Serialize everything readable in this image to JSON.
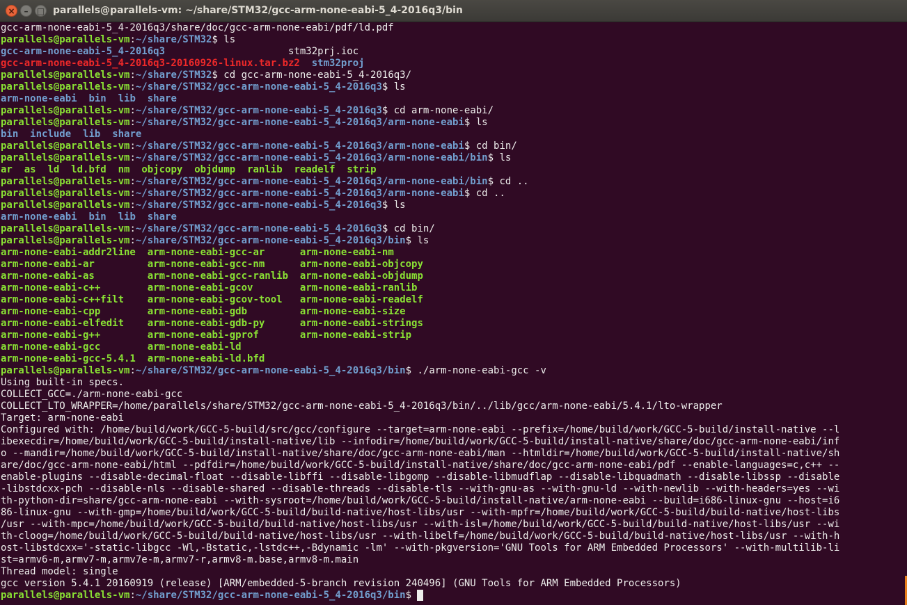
{
  "window": {
    "title": "parallels@parallels-vm: ~/share/STM32/gcc-arm-none-eabi-5_4-2016q3/bin",
    "close_glyph": "×",
    "minimize_glyph": "–",
    "maximize_glyph": "□"
  },
  "colors": {
    "background": "#300a24",
    "prompt": "#8ae234",
    "path": "#729fcf",
    "directory": "#729fcf",
    "executable": "#8ae234",
    "archive": "#ef2929",
    "text": "#eeeeec",
    "scrollbar": "#e87f1c"
  },
  "terminal": {
    "lines": [
      [
        {
          "t": "gcc-arm-none-eabi-5_4-2016q3/share/doc/gcc-arm-none-eabi/pdf/ld.pdf",
          "c": "text"
        }
      ],
      [
        {
          "t": "parallels@parallels-vm",
          "c": "prompt"
        },
        {
          "t": ":",
          "c": "text"
        },
        {
          "t": "~/share/STM32",
          "c": "path"
        },
        {
          "t": "$ ls",
          "c": "text"
        }
      ],
      [
        {
          "t": "gcc-arm-none-eabi-5_4-2016q3",
          "c": "dir"
        },
        {
          "t": "                     stm32prj.ioc",
          "c": "text"
        }
      ],
      [
        {
          "t": "gcc-arm-none-eabi-5_4-2016q3-20160926-linux.tar.bz2",
          "c": "arc"
        },
        {
          "t": "  ",
          "c": "text"
        },
        {
          "t": "stm32proj",
          "c": "dir"
        }
      ],
      [
        {
          "t": "parallels@parallels-vm",
          "c": "prompt"
        },
        {
          "t": ":",
          "c": "text"
        },
        {
          "t": "~/share/STM32",
          "c": "path"
        },
        {
          "t": "$ cd gcc-arm-none-eabi-5_4-2016q3/",
          "c": "text"
        }
      ],
      [
        {
          "t": "parallels@parallels-vm",
          "c": "prompt"
        },
        {
          "t": ":",
          "c": "text"
        },
        {
          "t": "~/share/STM32/gcc-arm-none-eabi-5_4-2016q3",
          "c": "path"
        },
        {
          "t": "$ ls",
          "c": "text"
        }
      ],
      [
        {
          "t": "arm-none-eabi",
          "c": "dir"
        },
        {
          "t": "  ",
          "c": "text"
        },
        {
          "t": "bin",
          "c": "dir"
        },
        {
          "t": "  ",
          "c": "text"
        },
        {
          "t": "lib",
          "c": "dir"
        },
        {
          "t": "  ",
          "c": "text"
        },
        {
          "t": "share",
          "c": "dir"
        }
      ],
      [
        {
          "t": "parallels@parallels-vm",
          "c": "prompt"
        },
        {
          "t": ":",
          "c": "text"
        },
        {
          "t": "~/share/STM32/gcc-arm-none-eabi-5_4-2016q3",
          "c": "path"
        },
        {
          "t": "$ cd arm-none-eabi/",
          "c": "text"
        }
      ],
      [
        {
          "t": "parallels@parallels-vm",
          "c": "prompt"
        },
        {
          "t": ":",
          "c": "text"
        },
        {
          "t": "~/share/STM32/gcc-arm-none-eabi-5_4-2016q3/arm-none-eabi",
          "c": "path"
        },
        {
          "t": "$ ls",
          "c": "text"
        }
      ],
      [
        {
          "t": "bin",
          "c": "dir"
        },
        {
          "t": "  ",
          "c": "text"
        },
        {
          "t": "include",
          "c": "dir"
        },
        {
          "t": "  ",
          "c": "text"
        },
        {
          "t": "lib",
          "c": "dir"
        },
        {
          "t": "  ",
          "c": "text"
        },
        {
          "t": "share",
          "c": "dir"
        }
      ],
      [
        {
          "t": "parallels@parallels-vm",
          "c": "prompt"
        },
        {
          "t": ":",
          "c": "text"
        },
        {
          "t": "~/share/STM32/gcc-arm-none-eabi-5_4-2016q3/arm-none-eabi",
          "c": "path"
        },
        {
          "t": "$ cd bin/",
          "c": "text"
        }
      ],
      [
        {
          "t": "parallels@parallels-vm",
          "c": "prompt"
        },
        {
          "t": ":",
          "c": "text"
        },
        {
          "t": "~/share/STM32/gcc-arm-none-eabi-5_4-2016q3/arm-none-eabi/bin",
          "c": "path"
        },
        {
          "t": "$ ls",
          "c": "text"
        }
      ],
      [
        {
          "t": "ar",
          "c": "exe"
        },
        {
          "t": "  ",
          "c": "text"
        },
        {
          "t": "as",
          "c": "exe"
        },
        {
          "t": "  ",
          "c": "text"
        },
        {
          "t": "ld",
          "c": "exe"
        },
        {
          "t": "  ",
          "c": "text"
        },
        {
          "t": "ld.bfd",
          "c": "exe"
        },
        {
          "t": "  ",
          "c": "text"
        },
        {
          "t": "nm",
          "c": "exe"
        },
        {
          "t": "  ",
          "c": "text"
        },
        {
          "t": "objcopy",
          "c": "exe"
        },
        {
          "t": "  ",
          "c": "text"
        },
        {
          "t": "objdump",
          "c": "exe"
        },
        {
          "t": "  ",
          "c": "text"
        },
        {
          "t": "ranlib",
          "c": "exe"
        },
        {
          "t": "  ",
          "c": "text"
        },
        {
          "t": "readelf",
          "c": "exe"
        },
        {
          "t": "  ",
          "c": "text"
        },
        {
          "t": "strip",
          "c": "exe"
        }
      ],
      [
        {
          "t": "parallels@parallels-vm",
          "c": "prompt"
        },
        {
          "t": ":",
          "c": "text"
        },
        {
          "t": "~/share/STM32/gcc-arm-none-eabi-5_4-2016q3/arm-none-eabi/bin",
          "c": "path"
        },
        {
          "t": "$ cd ..",
          "c": "text"
        }
      ],
      [
        {
          "t": "parallels@parallels-vm",
          "c": "prompt"
        },
        {
          "t": ":",
          "c": "text"
        },
        {
          "t": "~/share/STM32/gcc-arm-none-eabi-5_4-2016q3/arm-none-eabi",
          "c": "path"
        },
        {
          "t": "$ cd ..",
          "c": "text"
        }
      ],
      [
        {
          "t": "parallels@parallels-vm",
          "c": "prompt"
        },
        {
          "t": ":",
          "c": "text"
        },
        {
          "t": "~/share/STM32/gcc-arm-none-eabi-5_4-2016q3",
          "c": "path"
        },
        {
          "t": "$ ls",
          "c": "text"
        }
      ],
      [
        {
          "t": "arm-none-eabi",
          "c": "dir"
        },
        {
          "t": "  ",
          "c": "text"
        },
        {
          "t": "bin",
          "c": "dir"
        },
        {
          "t": "  ",
          "c": "text"
        },
        {
          "t": "lib",
          "c": "dir"
        },
        {
          "t": "  ",
          "c": "text"
        },
        {
          "t": "share",
          "c": "dir"
        }
      ],
      [
        {
          "t": "parallels@parallels-vm",
          "c": "prompt"
        },
        {
          "t": ":",
          "c": "text"
        },
        {
          "t": "~/share/STM32/gcc-arm-none-eabi-5_4-2016q3",
          "c": "path"
        },
        {
          "t": "$ cd bin/",
          "c": "text"
        }
      ],
      [
        {
          "t": "parallels@parallels-vm",
          "c": "prompt"
        },
        {
          "t": ":",
          "c": "text"
        },
        {
          "t": "~/share/STM32/gcc-arm-none-eabi-5_4-2016q3/bin",
          "c": "path"
        },
        {
          "t": "$ ls",
          "c": "text"
        }
      ],
      [
        {
          "t": "arm-none-eabi-addr2line",
          "c": "exe"
        },
        {
          "t": "  ",
          "c": "text"
        },
        {
          "t": "arm-none-eabi-gcc-ar",
          "c": "exe"
        },
        {
          "t": "      ",
          "c": "text"
        },
        {
          "t": "arm-none-eabi-nm",
          "c": "exe"
        }
      ],
      [
        {
          "t": "arm-none-eabi-ar",
          "c": "exe"
        },
        {
          "t": "         ",
          "c": "text"
        },
        {
          "t": "arm-none-eabi-gcc-nm",
          "c": "exe"
        },
        {
          "t": "      ",
          "c": "text"
        },
        {
          "t": "arm-none-eabi-objcopy",
          "c": "exe"
        }
      ],
      [
        {
          "t": "arm-none-eabi-as",
          "c": "exe"
        },
        {
          "t": "         ",
          "c": "text"
        },
        {
          "t": "arm-none-eabi-gcc-ranlib",
          "c": "exe"
        },
        {
          "t": "  ",
          "c": "text"
        },
        {
          "t": "arm-none-eabi-objdump",
          "c": "exe"
        }
      ],
      [
        {
          "t": "arm-none-eabi-c++",
          "c": "exe"
        },
        {
          "t": "        ",
          "c": "text"
        },
        {
          "t": "arm-none-eabi-gcov",
          "c": "exe"
        },
        {
          "t": "        ",
          "c": "text"
        },
        {
          "t": "arm-none-eabi-ranlib",
          "c": "exe"
        }
      ],
      [
        {
          "t": "arm-none-eabi-c++filt",
          "c": "exe"
        },
        {
          "t": "    ",
          "c": "text"
        },
        {
          "t": "arm-none-eabi-gcov-tool",
          "c": "exe"
        },
        {
          "t": "   ",
          "c": "text"
        },
        {
          "t": "arm-none-eabi-readelf",
          "c": "exe"
        }
      ],
      [
        {
          "t": "arm-none-eabi-cpp",
          "c": "exe"
        },
        {
          "t": "        ",
          "c": "text"
        },
        {
          "t": "arm-none-eabi-gdb",
          "c": "exe"
        },
        {
          "t": "         ",
          "c": "text"
        },
        {
          "t": "arm-none-eabi-size",
          "c": "exe"
        }
      ],
      [
        {
          "t": "arm-none-eabi-elfedit",
          "c": "exe"
        },
        {
          "t": "    ",
          "c": "text"
        },
        {
          "t": "arm-none-eabi-gdb-py",
          "c": "exe"
        },
        {
          "t": "      ",
          "c": "text"
        },
        {
          "t": "arm-none-eabi-strings",
          "c": "exe"
        }
      ],
      [
        {
          "t": "arm-none-eabi-g++",
          "c": "exe"
        },
        {
          "t": "        ",
          "c": "text"
        },
        {
          "t": "arm-none-eabi-gprof",
          "c": "exe"
        },
        {
          "t": "       ",
          "c": "text"
        },
        {
          "t": "arm-none-eabi-strip",
          "c": "exe"
        }
      ],
      [
        {
          "t": "arm-none-eabi-gcc",
          "c": "exe"
        },
        {
          "t": "        ",
          "c": "text"
        },
        {
          "t": "arm-none-eabi-ld",
          "c": "exe"
        }
      ],
      [
        {
          "t": "arm-none-eabi-gcc-5.4.1",
          "c": "exe"
        },
        {
          "t": "  ",
          "c": "text"
        },
        {
          "t": "arm-none-eabi-ld.bfd",
          "c": "exe"
        }
      ],
      [
        {
          "t": "parallels@parallels-vm",
          "c": "prompt"
        },
        {
          "t": ":",
          "c": "text"
        },
        {
          "t": "~/share/STM32/gcc-arm-none-eabi-5_4-2016q3/bin",
          "c": "path"
        },
        {
          "t": "$ ./arm-none-eabi-gcc -v",
          "c": "text"
        }
      ],
      [
        {
          "t": "Using built-in specs.",
          "c": "text"
        }
      ],
      [
        {
          "t": "COLLECT_GCC=./arm-none-eabi-gcc",
          "c": "text"
        }
      ],
      [
        {
          "t": "COLLECT_LTO_WRAPPER=/home/parallels/share/STM32/gcc-arm-none-eabi-5_4-2016q3/bin/../lib/gcc/arm-none-eabi/5.4.1/lto-wrapper",
          "c": "text"
        }
      ],
      [
        {
          "t": "Target: arm-none-eabi",
          "c": "text"
        }
      ],
      [
        {
          "t": "Configured with: /home/build/work/GCC-5-build/src/gcc/configure --target=arm-none-eabi --prefix=/home/build/work/GCC-5-build/install-native --l",
          "c": "text"
        }
      ],
      [
        {
          "t": "ibexecdir=/home/build/work/GCC-5-build/install-native/lib --infodir=/home/build/work/GCC-5-build/install-native/share/doc/gcc-arm-none-eabi/inf",
          "c": "text"
        }
      ],
      [
        {
          "t": "o --mandir=/home/build/work/GCC-5-build/install-native/share/doc/gcc-arm-none-eabi/man --htmldir=/home/build/work/GCC-5-build/install-native/sh",
          "c": "text"
        }
      ],
      [
        {
          "t": "are/doc/gcc-arm-none-eabi/html --pdfdir=/home/build/work/GCC-5-build/install-native/share/doc/gcc-arm-none-eabi/pdf --enable-languages=c,c++ --",
          "c": "text"
        }
      ],
      [
        {
          "t": "enable-plugins --disable-decimal-float --disable-libffi --disable-libgomp --disable-libmudflap --disable-libquadmath --disable-libssp --disable",
          "c": "text"
        }
      ],
      [
        {
          "t": "-libstdcxx-pch --disable-nls --disable-shared --disable-threads --disable-tls --with-gnu-as --with-gnu-ld --with-newlib --with-headers=yes --wi",
          "c": "text"
        }
      ],
      [
        {
          "t": "th-python-dir=share/gcc-arm-none-eabi --with-sysroot=/home/build/work/GCC-5-build/install-native/arm-none-eabi --build=i686-linux-gnu --host=i6",
          "c": "text"
        }
      ],
      [
        {
          "t": "86-linux-gnu --with-gmp=/home/build/work/GCC-5-build/build-native/host-libs/usr --with-mpfr=/home/build/work/GCC-5-build/build-native/host-libs",
          "c": "text"
        }
      ],
      [
        {
          "t": "/usr --with-mpc=/home/build/work/GCC-5-build/build-native/host-libs/usr --with-isl=/home/build/work/GCC-5-build/build-native/host-libs/usr --wi",
          "c": "text"
        }
      ],
      [
        {
          "t": "th-cloog=/home/build/work/GCC-5-build/build-native/host-libs/usr --with-libelf=/home/build/work/GCC-5-build/build-native/host-libs/usr --with-h",
          "c": "text"
        }
      ],
      [
        {
          "t": "ost-libstdcxx='-static-libgcc -Wl,-Bstatic,-lstdc++,-Bdynamic -lm' --with-pkgversion='GNU Tools for ARM Embedded Processors' --with-multilib-li",
          "c": "text"
        }
      ],
      [
        {
          "t": "st=armv6-m,armv7-m,armv7e-m,armv7-r,armv8-m.base,armv8-m.main",
          "c": "text"
        }
      ],
      [
        {
          "t": "Thread model: single",
          "c": "text"
        }
      ],
      [
        {
          "t": "gcc version 5.4.1 20160919 (release) [ARM/embedded-5-branch revision 240496] (GNU Tools for ARM Embedded Processors)",
          "c": "text"
        }
      ],
      [
        {
          "t": "parallels@parallels-vm",
          "c": "prompt"
        },
        {
          "t": ":",
          "c": "text"
        },
        {
          "t": "~/share/STM32/gcc-arm-none-eabi-5_4-2016q3/bin",
          "c": "path"
        },
        {
          "t": "$ ",
          "c": "text"
        }
      ]
    ]
  }
}
